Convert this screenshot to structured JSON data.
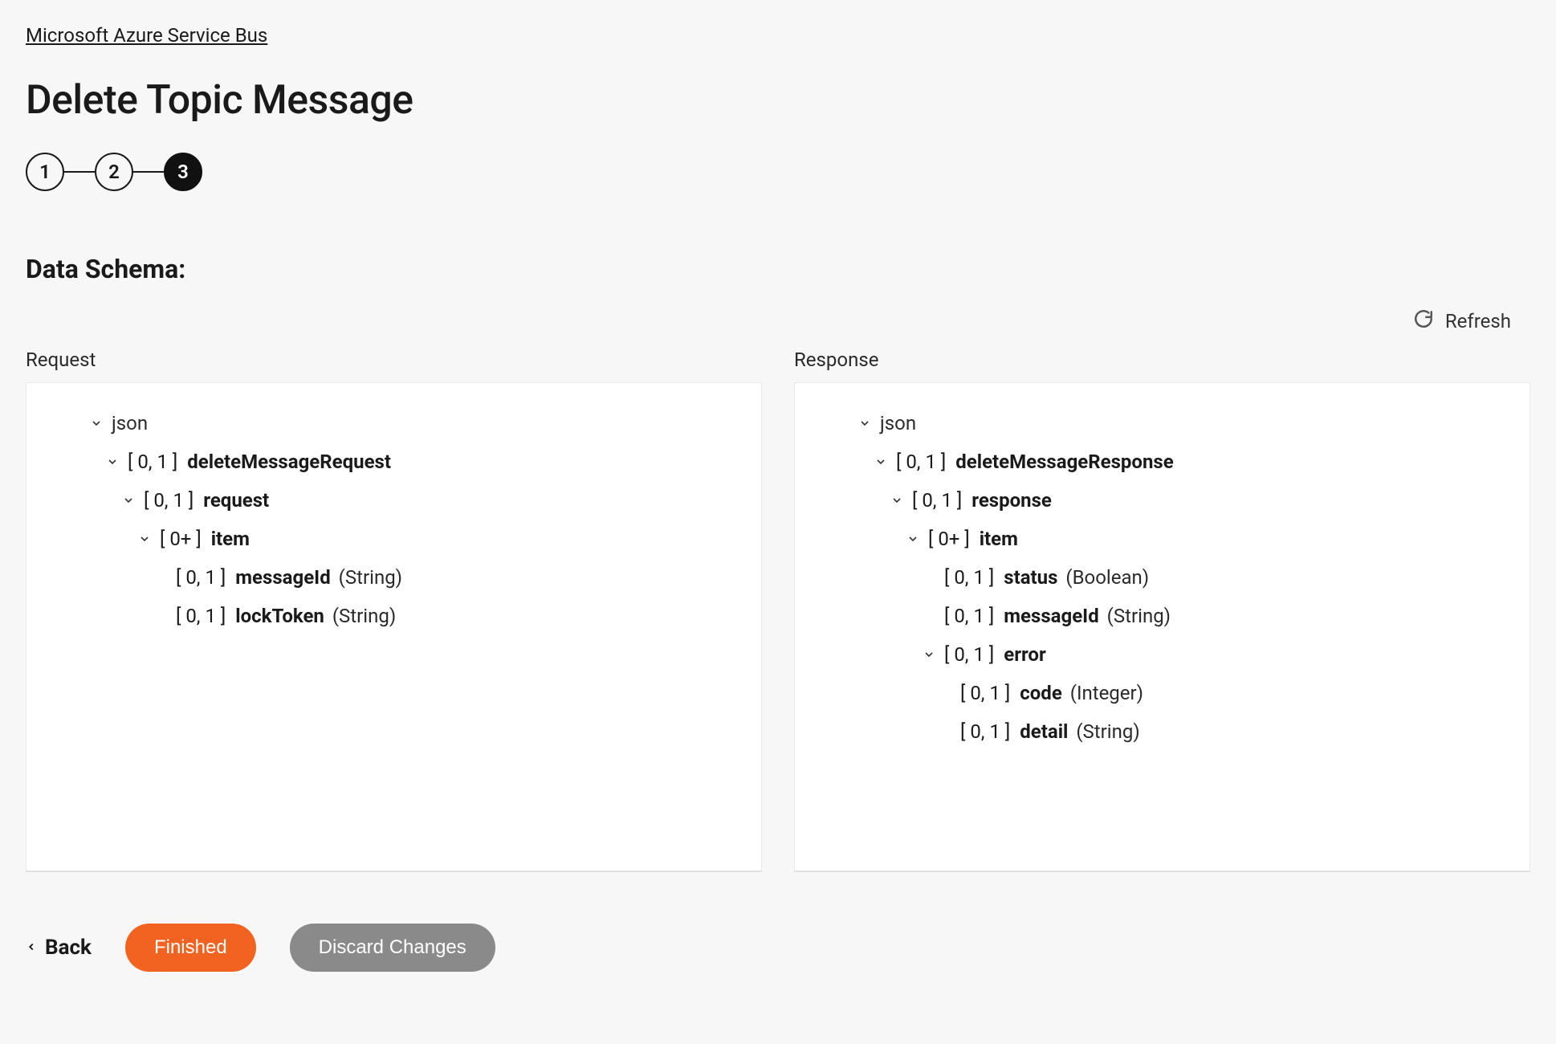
{
  "breadcrumb": {
    "label": "Microsoft Azure Service Bus"
  },
  "page": {
    "title": "Delete Topic Message"
  },
  "stepper": {
    "steps": [
      {
        "num": "1",
        "active": false
      },
      {
        "num": "2",
        "active": false
      },
      {
        "num": "3",
        "active": true
      }
    ]
  },
  "section": {
    "title": "Data Schema:"
  },
  "refresh": {
    "label": "Refresh"
  },
  "columns": {
    "request_label": "Request",
    "response_label": "Response"
  },
  "request_tree": {
    "root": "json",
    "n0": {
      "card": "[ 0, 1 ]",
      "name": "deleteMessageRequest"
    },
    "n1": {
      "card": "[ 0, 1 ]",
      "name": "request"
    },
    "n2": {
      "card": "[ 0+ ]",
      "name": "item"
    },
    "n3": {
      "card": "[ 0, 1 ]",
      "name": "messageId",
      "type": "(String)"
    },
    "n4": {
      "card": "[ 0, 1 ]",
      "name": "lockToken",
      "type": "(String)"
    }
  },
  "response_tree": {
    "root": "json",
    "n0": {
      "card": "[ 0, 1 ]",
      "name": "deleteMessageResponse"
    },
    "n1": {
      "card": "[ 0, 1 ]",
      "name": "response"
    },
    "n2": {
      "card": "[ 0+ ]",
      "name": "item"
    },
    "n3": {
      "card": "[ 0, 1 ]",
      "name": "status",
      "type": "(Boolean)"
    },
    "n4": {
      "card": "[ 0, 1 ]",
      "name": "messageId",
      "type": "(String)"
    },
    "n5": {
      "card": "[ 0, 1 ]",
      "name": "error"
    },
    "n6": {
      "card": "[ 0, 1 ]",
      "name": "code",
      "type": "(Integer)"
    },
    "n7": {
      "card": "[ 0, 1 ]",
      "name": "detail",
      "type": "(String)"
    }
  },
  "actions": {
    "back": "Back",
    "finished": "Finished",
    "discard": "Discard Changes"
  }
}
